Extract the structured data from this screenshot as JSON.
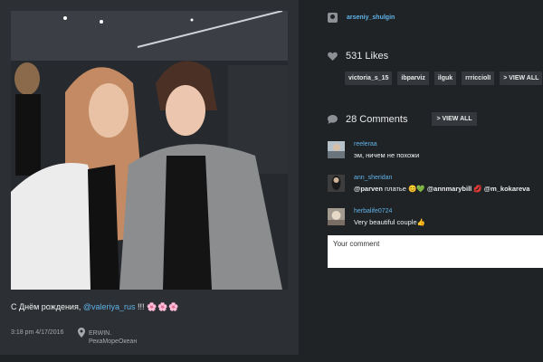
{
  "post": {
    "caption_prefix": "С Днём рождения, ",
    "caption_mention": "@valeriya_rus",
    "caption_suffix": " !!! ",
    "caption_emoji": "🌸🌸🌸",
    "time": "3:18 pm 4/17/2016",
    "location_line1": "ERWIN.",
    "location_line2": "РекаМореОкеан"
  },
  "author": {
    "username": "arseniy_shulgin"
  },
  "likes": {
    "count_label": "531 Likes",
    "users": [
      "victoria_s_15",
      "ibparviz",
      "ilguk",
      "rrricciolI"
    ],
    "view_all_label": "> VIEW ALL"
  },
  "comments": {
    "count_label": "28 Comments",
    "view_all_label": "> VIEW ALL",
    "items": [
      {
        "user": "reeleraa",
        "text": "эм, ничем не похожи"
      },
      {
        "user": "ann_sheridan",
        "text_prefix": "@parven",
        "text_mid": " платье ",
        "emoji1": "😊",
        "emoji2": "💚",
        "mention2": "@annmarybill",
        "emoji3": "💋",
        "mention3": "@m_kokareva"
      },
      {
        "user": "herbalife0724",
        "text": "Very beautiful couple👍"
      }
    ],
    "input_placeholder": "Your comment"
  },
  "colors": {
    "background": "#202326",
    "card": "#2c2f33",
    "link": "#5fb3e8",
    "chip": "#34383d"
  },
  "icons": {
    "user": "user-icon",
    "likes": "heart-icon",
    "comments": "speech-bubble-icon",
    "location": "map-pin-icon"
  }
}
